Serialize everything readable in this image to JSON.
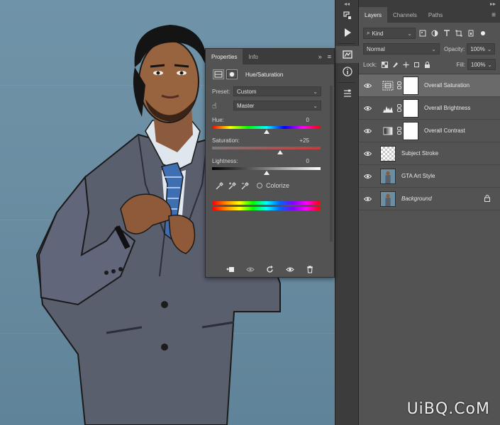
{
  "layers_panel": {
    "tabs": [
      "Layers",
      "Channels",
      "Paths"
    ],
    "filter_label": "Kind",
    "blend_mode": "Normal",
    "opacity_label": "Opacity:",
    "opacity_value": "100%",
    "lock_label": "Lock:",
    "fill_label": "Fill:",
    "fill_value": "100%",
    "layers": [
      {
        "name": "Overall Saturation",
        "type": "adjustment-hue-saturation",
        "selected": true
      },
      {
        "name": "Overall Brightness",
        "type": "adjustment-levels",
        "selected": false
      },
      {
        "name": "Overall Contrast",
        "type": "adjustment-gradient-map",
        "selected": false
      },
      {
        "name": "Subject Stroke",
        "type": "transparent",
        "selected": false
      },
      {
        "name": "GTA Art Style",
        "type": "image",
        "selected": false
      },
      {
        "name": "Background",
        "type": "image-locked",
        "selected": false
      }
    ]
  },
  "properties_panel": {
    "tabs": [
      "Properties",
      "Info"
    ],
    "adjustment_title": "Hue/Saturation",
    "preset_label": "Preset:",
    "preset_value": "Custom",
    "channel_value": "Master",
    "hue": {
      "label": "Hue:",
      "value": "0",
      "level": 0.5
    },
    "saturation": {
      "label": "Saturation:",
      "value": "+25",
      "level": 0.625
    },
    "lightness": {
      "label": "Lightness:",
      "value": "0",
      "level": 0.5
    },
    "colorize_label": "Colorize"
  },
  "watermark": "UiBQ.CoM",
  "colors": {
    "panel_bg": "#535353",
    "panel_dark": "#3c3c3c",
    "selected_layer": "#6a6a6a",
    "canvas_wall": "#6f93a8",
    "suit": "#5a5f6e"
  }
}
